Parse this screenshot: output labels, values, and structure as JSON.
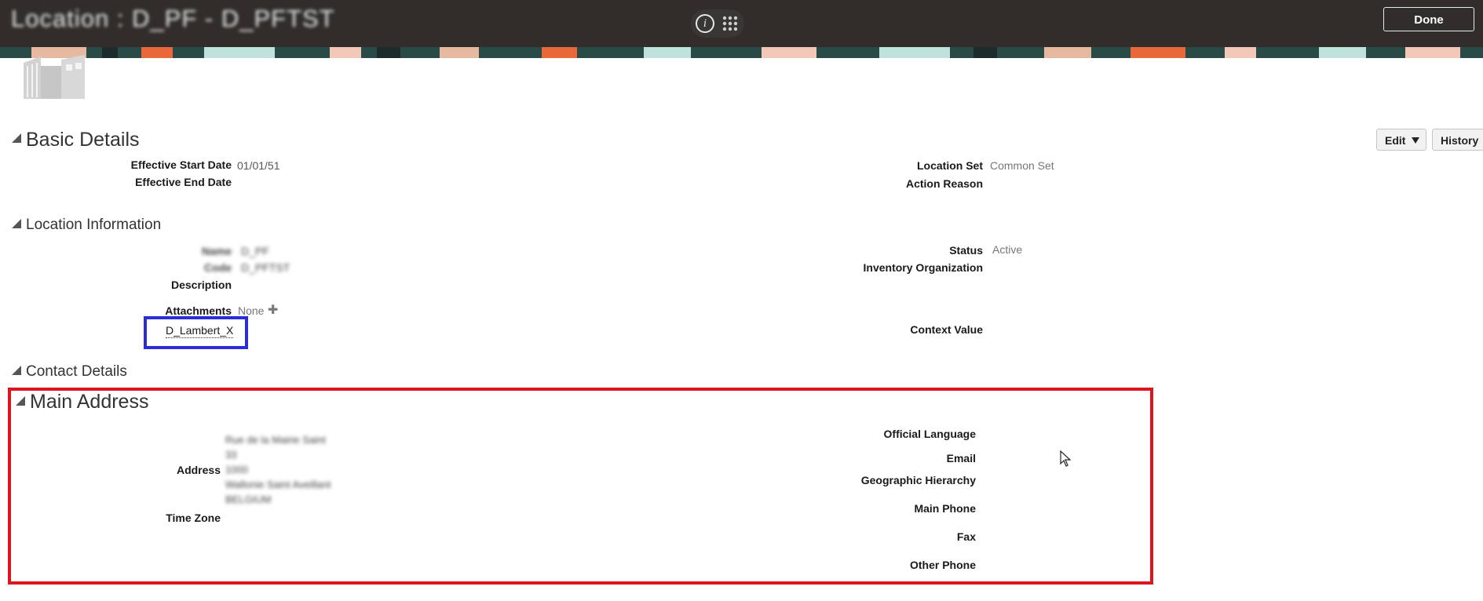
{
  "header": {
    "title": "Location : D_PF - D_PFTST",
    "info_label": "i",
    "done_label": "Done"
  },
  "toolbar": {
    "edit_label": "Edit",
    "history_label": "History"
  },
  "basic_details": {
    "title": "Basic Details",
    "effective_start_label": "Effective Start Date",
    "effective_start_value": "01/01/51",
    "effective_end_label": "Effective End Date",
    "location_set_label": "Location Set",
    "location_set_value": "Common Set",
    "action_reason_label": "Action Reason"
  },
  "location_information": {
    "title": "Location Information",
    "name_label": "Name",
    "name_value": "D_PF",
    "code_label": "Code",
    "code_value": "D_PFTST",
    "description_label": "Description",
    "attachments_label": "Attachments",
    "attachments_value": "None",
    "add_symbol": "✚",
    "context_link": "D_Lambert_X",
    "status_label": "Status",
    "status_value": "Active",
    "inventory_org_label": "Inventory Organization",
    "context_value_label": "Context Value"
  },
  "contact_details": {
    "title": "Contact Details"
  },
  "main_address": {
    "title": "Main Address",
    "address_label": "Address",
    "address_lines": [
      "Rue de la Mairie Saint",
      "33",
      "1000",
      "Wallonie Saint Aveillant",
      "BELGIUM"
    ],
    "time_zone_label": "Time Zone",
    "official_language_label": "Official Language",
    "email_label": "Email",
    "geo_hierarchy_label": "Geographic Hierarchy",
    "main_phone_label": "Main Phone",
    "fax_label": "Fax",
    "other_phone_label": "Other Phone"
  },
  "colors": {
    "topbar": "#312d2a",
    "highlight_blue": "#2d2dd6",
    "highlight_red": "#e0141c"
  },
  "icons": [
    "info-icon",
    "apps-grid-icon",
    "location-building-icon",
    "collapse-triangle-icon",
    "dropdown-arrow-icon",
    "add-icon",
    "mouse-cursor-icon"
  ]
}
